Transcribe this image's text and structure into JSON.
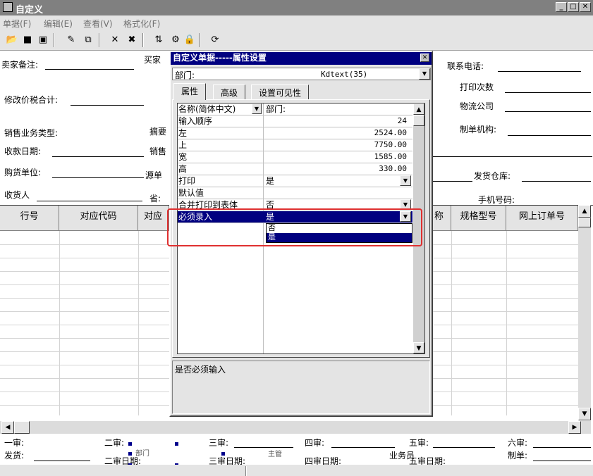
{
  "window": {
    "title": "自定义",
    "min": "_",
    "max": "□",
    "close": "✕"
  },
  "menu": [
    "单据(F)",
    "编辑(E)",
    "查看(V)",
    "格式化(F)"
  ],
  "toolbar_icons": [
    "open-folder-icon",
    "save-icon",
    "export-icon",
    "edit-icon",
    "copy-icon",
    "delete-icon",
    "delete-all-icon",
    "align-icon",
    "settings-icon",
    "lock-icon",
    "refresh-icon"
  ],
  "header_fields": {
    "buyer_note": "卖家备注:",
    "buyer_trunc": "买家",
    "contact_phone": "联系电话:",
    "print_count": "打印次数",
    "modify_tax_total": "修改价税合计:",
    "logistics": "物流公司",
    "sales_type": "销售业务类型:",
    "summary": "摘要",
    "issuer_org": "制单机构:",
    "receipt_date": "收款日期:",
    "sales_trunc": "销售",
    "purchaser": "购货单位:",
    "source_trunc": "源单",
    "ship_warehouse": "发货仓库:",
    "consignee": "收货人",
    "province": "省:",
    "mobile": "手机号码:"
  },
  "grid": {
    "columns": [
      "行号",
      "对应代码",
      "对应",
      "称",
      "规格型号",
      "网上订单号"
    ]
  },
  "footer": {
    "audit1": "一审:",
    "audit2": "二审:",
    "audit3": "三审:",
    "audit4": "四审:",
    "audit5": "五审:",
    "audit6": "六审:",
    "ship": "发货:",
    "audit2_date": "二审日期:",
    "audit3_date": "三审日期:",
    "audit4_date": "四审日期:",
    "audit5_date": "五审日期:",
    "maker": "制单:",
    "salesman": "业务员",
    "truncated_1": "部门",
    "truncated_2": "主管"
  },
  "dialog": {
    "title": "自定义单据-----属性设置",
    "close": "✕",
    "field_label": "部门:",
    "field_value": "Kdtext(35)",
    "tabs": [
      "属性",
      "高级",
      "设置可见性"
    ],
    "name_header": "名称(简体中文)",
    "name_value": "部门:",
    "properties": [
      {
        "name": "输入顺序",
        "value": "24",
        "num": true
      },
      {
        "name": "左",
        "value": "2524.00",
        "num": true
      },
      {
        "name": "上",
        "value": "7750.00",
        "num": true
      },
      {
        "name": "宽",
        "value": "1585.00",
        "num": true
      },
      {
        "name": "高",
        "value": "330.00",
        "num": true
      },
      {
        "name": "打印",
        "value": "是",
        "dropdown": true
      },
      {
        "name": "默认值",
        "value": ""
      },
      {
        "name": "合并打印到表体",
        "value": "否",
        "dropdown": true
      },
      {
        "name": "必须录入",
        "value": "是",
        "dropdown": true,
        "selected": true
      }
    ],
    "dropdown_options": [
      "否",
      "是"
    ],
    "description": "是否必须输入"
  }
}
